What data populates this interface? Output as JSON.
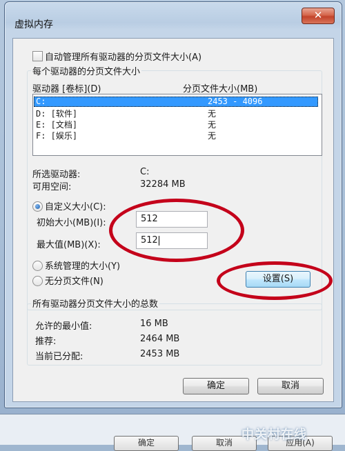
{
  "window": {
    "title": "虚拟内存",
    "close_glyph": "✕"
  },
  "auto_manage": {
    "label": "自动管理所有驱动器的分页文件大小(A)",
    "checked": false
  },
  "drives_group": {
    "label": "每个驱动器的分页文件大小",
    "col_drive": "驱动器 [卷标](D)",
    "col_size": "分页文件大小(MB)",
    "rows": [
      {
        "drive": "C:",
        "size": "2453 - 4096",
        "selected": true
      },
      {
        "drive": "D:  [软件]",
        "size": "无",
        "selected": false
      },
      {
        "drive": "E:  [文档]",
        "size": "无",
        "selected": false
      },
      {
        "drive": "F:  [娱乐]",
        "size": "无",
        "selected": false
      }
    ],
    "selected_drive_label": "所选驱动器:",
    "selected_drive_value": "C:",
    "free_space_label": "可用空间:",
    "free_space_value": "32284 MB",
    "custom_size_label": "自定义大小(C):",
    "initial_size_label": "初始大小(MB)(I):",
    "initial_size_value": "512",
    "max_size_label": "最大值(MB)(X):",
    "max_size_value": "512",
    "system_managed_label": "系统管理的大小(Y)",
    "no_paging_label": "无分页文件(N)",
    "set_button": "设置(S)"
  },
  "totals_group": {
    "label": "所有驱动器分页文件大小的总数",
    "min_label": "允许的最小值:",
    "min_value": "16 MB",
    "recommended_label": "推荐:",
    "recommended_value": "2464 MB",
    "allocated_label": "当前已分配:",
    "allocated_value": "2453 MB"
  },
  "buttons": {
    "ok": "确定",
    "cancel": "取消"
  },
  "background": {
    "ok": "确定",
    "cancel": "取消",
    "apply": "应用(A)",
    "watermark": "中关村在线"
  },
  "colors": {
    "highlight": "#3399ff",
    "annotation": "#c4001a"
  }
}
